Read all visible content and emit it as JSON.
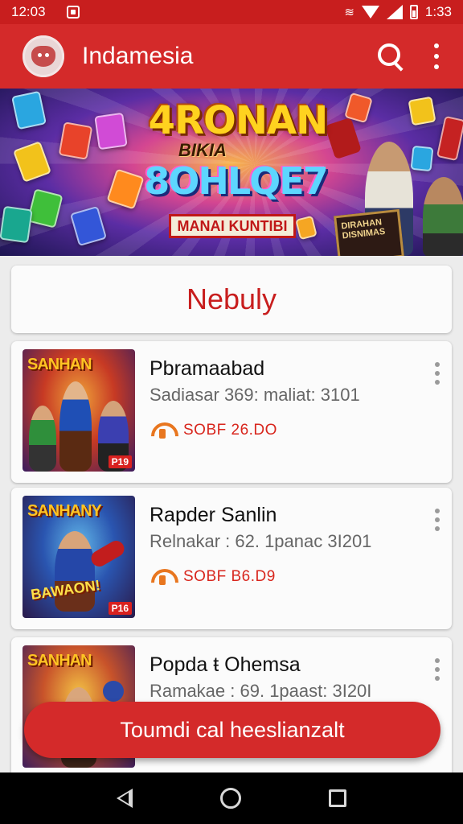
{
  "status_bar": {
    "time_left": "12:03",
    "time_right": "1:33",
    "notification_icon": "photo-icon",
    "icons": [
      "vibrate-icon",
      "wifi-icon",
      "signal-icon",
      "battery-icon"
    ]
  },
  "app_bar": {
    "title": "Indamesia",
    "logo_icon": "mascot-logo-icon",
    "search_icon": "search-icon",
    "more_icon": "more-vert-icon"
  },
  "banner": {
    "title": "4RONAN",
    "kicker": "BIKIA",
    "subtitle": "8OHLQE7",
    "ribbon": "MANAI KUNTIBI",
    "sign_text": "DIRAHAN DISNIMAS"
  },
  "section": {
    "title": "Nebuly"
  },
  "items": [
    {
      "title": "Pbramaabad",
      "meta": "Sadiasar 369: maliat: 3101",
      "price": "SOBF 26.DO",
      "thumb_title": "SANHAN",
      "thumb_sub": "",
      "thumb_badge": "P19"
    },
    {
      "title": "Rapder Sanlin",
      "meta": "Relnakar : 62. 1panac 3I201",
      "price": "SOBF B6.D9",
      "thumb_title": "SANHANY",
      "thumb_sub": "BAWAON!",
      "thumb_badge": "P16"
    },
    {
      "title": "Popda ŧ Ohemsa",
      "meta": "Ramakae : 69. 1paast: 3I20I",
      "price": "",
      "thumb_title": "SANHAN",
      "thumb_sub": "",
      "thumb_badge": ""
    }
  ],
  "cta": {
    "label": "Toumdi cal heeslianzalt"
  },
  "colors": {
    "primary": "#d42a2a",
    "status_bar": "#c81e1e",
    "accent_price": "#d8261d",
    "price_icon": "#e8761f",
    "background": "#ececec"
  },
  "nav_bar": {
    "icons": [
      "back-icon",
      "home-icon",
      "recents-icon"
    ]
  }
}
